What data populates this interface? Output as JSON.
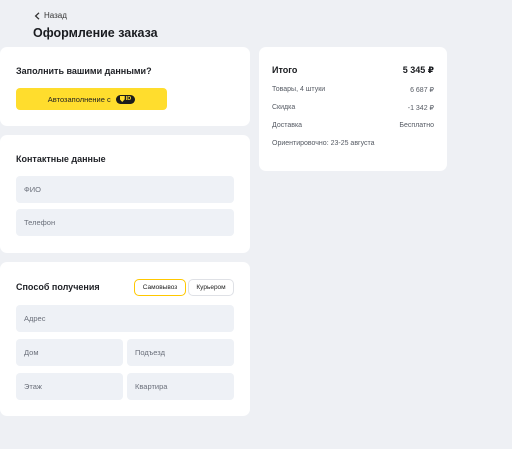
{
  "nav": {
    "back_label": "Назад"
  },
  "page": {
    "title": "Оформление заказа"
  },
  "autofill": {
    "heading": "Заполнить вашими данными?",
    "button_label": "Автозаполнение с",
    "logo_text": "ID",
    "button_color": "#ffdd2d"
  },
  "contacts": {
    "heading": "Контактные данные",
    "fields": {
      "name_placeholder": "ФИО",
      "phone_placeholder": "Телефон"
    }
  },
  "delivery": {
    "heading": "Способ получения",
    "options": [
      "Самовывоз",
      "Курьером"
    ],
    "selected": "Самовывоз",
    "fields": {
      "address": "Адрес",
      "house": "Дом",
      "entrance": "Подъезд",
      "floor": "Этаж",
      "apartment": "Квартира"
    }
  },
  "summary": {
    "total_label": "Итого",
    "total_value": "5 345 ₽",
    "items_label": "Товары, 4 штуки",
    "items_value": "6 687 ₽",
    "discount_label": "Скидка",
    "discount_value": "-1 342 ₽",
    "shipping_label": "Доставка",
    "shipping_value": "Бесплатно",
    "eta_text": "Ориентировочно: 23-25 августа"
  },
  "colors": {
    "background": "#eef0f4",
    "accent": "#ffdd2d",
    "field_bg": "#eef1f6"
  }
}
